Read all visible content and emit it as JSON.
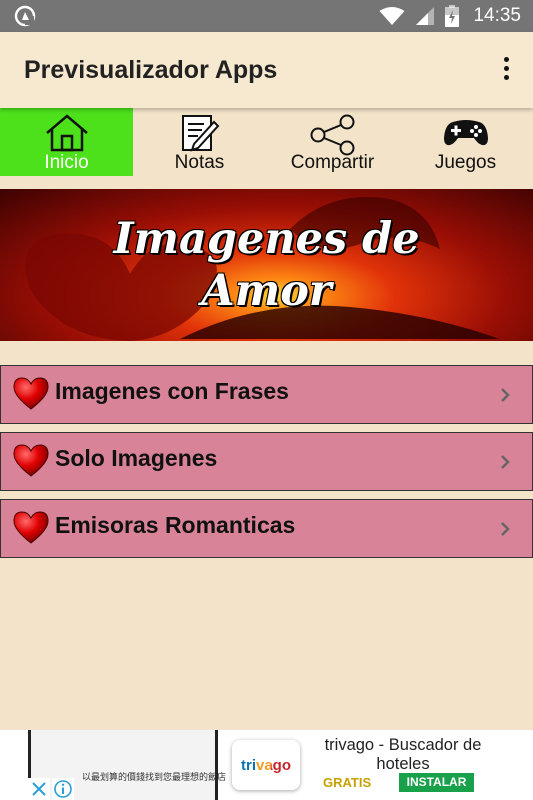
{
  "status_bar": {
    "time": "14:35",
    "icons": [
      "app-notification-icon",
      "wifi-icon",
      "signal-icon",
      "battery-icon"
    ]
  },
  "app_bar": {
    "title": "Previsualizador Apps",
    "menu_icon": "more-vertical-icon"
  },
  "tabs": [
    {
      "label": "Inicio",
      "icon": "home-icon",
      "active": true
    },
    {
      "label": "Notas",
      "icon": "notes-icon",
      "active": false
    },
    {
      "label": "Compartir",
      "icon": "share-icon",
      "active": false
    },
    {
      "label": "Juegos",
      "icon": "gamepad-icon",
      "active": false
    }
  ],
  "banner": {
    "line1": "Imagenes de",
    "line2": "Amor"
  },
  "menu_items": [
    {
      "label": "Imagenes con Frases",
      "icon": "heart-icon"
    },
    {
      "label": "Solo Imagenes",
      "icon": "heart-icon"
    },
    {
      "label": "Emisoras Romanticas",
      "icon": "heart-icon"
    }
  ],
  "ad": {
    "left_text": "以最划算的價錢找到您最理想的飯店",
    "logo_text": "trivago",
    "title": "trivago - Buscador de hoteles",
    "price": "GRATIS",
    "install_label": "INSTALAR"
  },
  "colors": {
    "status_bar": "#757575",
    "background": "#f3e4c9",
    "active_tab": "#4ce11b",
    "list_item": "#d88397",
    "install_button": "#18a04a"
  }
}
